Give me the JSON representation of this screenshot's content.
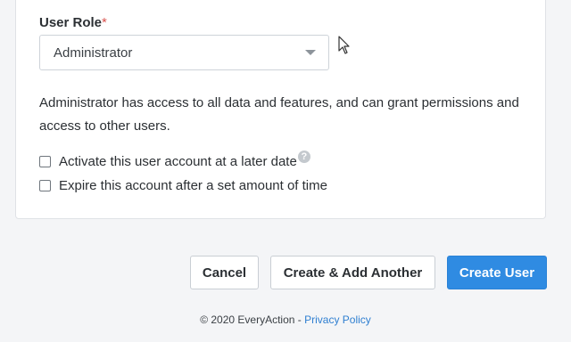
{
  "form": {
    "role_label": "User Role",
    "required_mark": "*",
    "role_selected": "Administrator",
    "role_description": "Administrator has access to all data and features, and can grant permissions and access to other users.",
    "activate_later_label": "Activate this user account at a later date",
    "activate_later_checked": false,
    "help_icon_glyph": "?",
    "expire_label": "Expire this account after a set amount of time",
    "expire_checked": false
  },
  "actions": {
    "cancel_label": "Cancel",
    "create_add_another_label": "Create & Add Another",
    "create_user_label": "Create User"
  },
  "footer": {
    "copyright": "© 2020 EveryAction",
    "separator": " - ",
    "privacy_link": "Privacy Policy"
  },
  "colors": {
    "primary": "#2f8be2",
    "required": "#d9534f",
    "link": "#2f7fd1"
  },
  "icons": {
    "caret": "chevron-down-icon",
    "help": "question-circle-icon",
    "cursor": "mouse-pointer-icon"
  }
}
